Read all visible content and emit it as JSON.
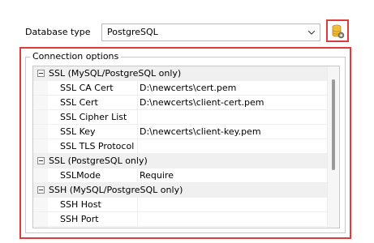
{
  "database": {
    "label": "Database type",
    "selected": "PostgreSQL",
    "settings_icon": "database-gear-icon"
  },
  "connection_options": {
    "title": "Connection options",
    "categories": [
      {
        "name": "SSL (MySQL/PostgreSQL only)",
        "items": [
          {
            "name": "SSL CA Cert",
            "value": "D:\\newcerts\\cert.pem"
          },
          {
            "name": "SSL Cert",
            "value": "D:\\newcerts\\client-cert.pem"
          },
          {
            "name": "SSL Cipher List",
            "value": ""
          },
          {
            "name": "SSL Key",
            "value": "D:\\newcerts\\client-key.pem"
          },
          {
            "name": "SSL TLS Protocol",
            "value": ""
          }
        ]
      },
      {
        "name": "SSL (PostgreSQL only)",
        "items": [
          {
            "name": "SSLMode",
            "value": "Require"
          }
        ]
      },
      {
        "name": "SSH (MySQL/PostgreSQL only)",
        "items": [
          {
            "name": "SSH Host",
            "value": ""
          },
          {
            "name": "SSH Port",
            "value": ""
          }
        ]
      }
    ]
  },
  "colors": {
    "highlight": "#e03b3b"
  }
}
